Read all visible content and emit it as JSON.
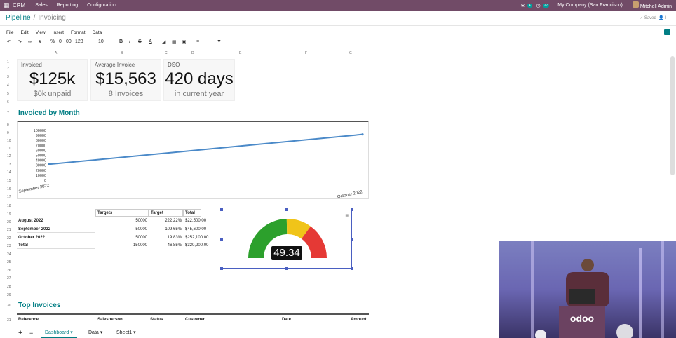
{
  "topbar": {
    "app_name": "CRM",
    "menu": [
      "Sales",
      "Reporting",
      "Configuration"
    ],
    "chat_badge": "4",
    "activity_badge": "27",
    "company": "My Company (San Francisco)",
    "user": "Mitchell Admin"
  },
  "breadcrumb": {
    "parent": "Pipeline",
    "current": "Invoicing"
  },
  "status": {
    "saved": "Saved"
  },
  "menubar": [
    "File",
    "Edit",
    "View",
    "Insert",
    "Format",
    "Data"
  ],
  "toolbar": {
    "percent": "%",
    "decimals0": "0",
    "decimals00": "00",
    "format": "123",
    "font_size": "10"
  },
  "columns": [
    "A",
    "B",
    "C",
    "D",
    "E",
    "F",
    "G"
  ],
  "rows": [
    "1",
    "2",
    "3",
    "4",
    "5",
    "6",
    "7",
    "8",
    "9",
    "10",
    "11",
    "12",
    "13",
    "14",
    "15",
    "16",
    "17",
    "18",
    "19",
    "20",
    "21",
    "22",
    "23",
    "24",
    "25",
    "26",
    "27",
    "28",
    "29",
    "30",
    "31"
  ],
  "scorecards": [
    {
      "title": "Invoiced",
      "value": "$125k",
      "sub": "$0k unpaid"
    },
    {
      "title": "Average Invoice",
      "value": "$15,563",
      "sub": "8 Invoices"
    },
    {
      "title": "DSO",
      "value": "420 days",
      "sub": "in current year"
    }
  ],
  "section_invoiced_by_month": "Invoiced by Month",
  "chart_data": {
    "type": "line",
    "title": "",
    "x": [
      "September 2022",
      "October 2022"
    ],
    "series": [
      {
        "values": [
          32000,
          92000
        ]
      }
    ],
    "yticks": [
      "100000",
      "90000",
      "80000",
      "70000",
      "60000",
      "50000",
      "40000",
      "30000",
      "20000",
      "10000",
      "0"
    ],
    "ylim": [
      0,
      100000
    ],
    "color": "#4a89c8"
  },
  "targets_table": {
    "headers": [
      "Targets",
      "Target",
      "Total"
    ],
    "rows": [
      {
        "label": "August 2022",
        "targets": "50000",
        "target": "222.22%",
        "total": "$22,500.00"
      },
      {
        "label": "September 2022",
        "targets": "50000",
        "target": "109.65%",
        "total": "$45,600.00"
      },
      {
        "label": "October 2022",
        "targets": "50000",
        "target": "19.83%",
        "total": "$252,100.00"
      },
      {
        "label": "Total",
        "targets": "150000",
        "target": "46.85%",
        "total": "$320,200.00"
      }
    ]
  },
  "gauge": {
    "value": "49.34",
    "colors": {
      "low": "#2ca02c",
      "mid": "#f0c419",
      "high": "#e53935"
    },
    "fraction": 0.4934
  },
  "section_top_invoices": "Top Invoices",
  "top_invoices_headers": [
    "Reference",
    "Salesperson",
    "Status",
    "Customer",
    "Date",
    "Amount"
  ],
  "sheets": [
    "Dashboard",
    "Data",
    "Sheet1"
  ],
  "video": {
    "podium_label": "odoo"
  }
}
